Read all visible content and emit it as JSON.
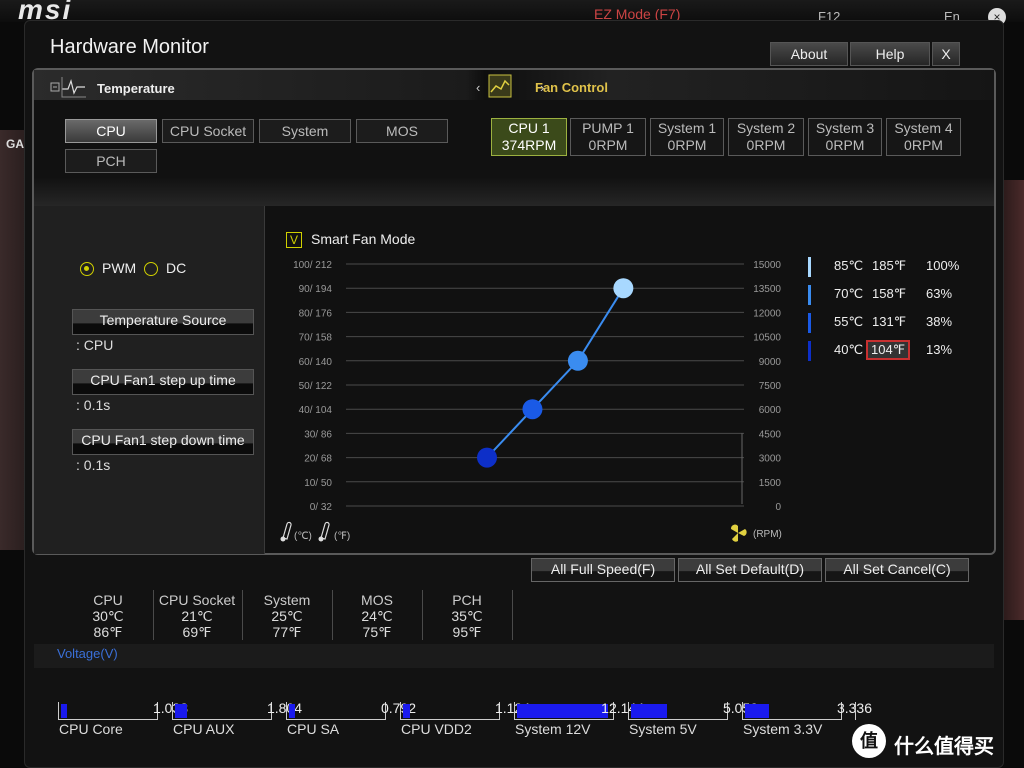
{
  "bg": {
    "logo": "msi",
    "ez_mode": "EZ Mode (F7)",
    "f12": "F12",
    "lang": "En",
    "close": "×",
    "side": "GA"
  },
  "window": {
    "title": "Hardware Monitor",
    "about": "About",
    "help": "Help",
    "close": "X"
  },
  "tabs": {
    "temperature": "Temperature",
    "fan_control": "Fan Control",
    "fan_arrows": "‹ ›"
  },
  "sources": [
    "CPU",
    "CPU Socket",
    "System",
    "MOS",
    "PCH"
  ],
  "fans": [
    {
      "name": "CPU 1",
      "rpm": "374RPM"
    },
    {
      "name": "PUMP 1",
      "rpm": "0RPM"
    },
    {
      "name": "System 1",
      "rpm": "0RPM"
    },
    {
      "name": "System 2",
      "rpm": "0RPM"
    },
    {
      "name": "System 3",
      "rpm": "0RPM"
    },
    {
      "name": "System 4",
      "rpm": "0RPM"
    }
  ],
  "mode": {
    "pwm": "PWM",
    "dc": "DC",
    "selected": "PWM"
  },
  "temp_source": {
    "label": "Temperature Source",
    "value": ": CPU"
  },
  "step_up": {
    "label": "CPU Fan1 step up time",
    "value": ": 0.1s"
  },
  "step_down": {
    "label": "CPU Fan1 step down time",
    "value": ": 0.1s"
  },
  "smart_fan": {
    "check": "V",
    "label": "Smart Fan Mode"
  },
  "chart_data": {
    "type": "line",
    "title": "",
    "y_left_ticks": [
      "100/ 212",
      "90/ 194",
      "80/ 176",
      "70/ 158",
      "60/ 140",
      "50/ 122",
      "40/ 104",
      "30/  86",
      "20/  68",
      "10/  50",
      "0/  32"
    ],
    "y_right_ticks": [
      "15000",
      "13500",
      "12000",
      "10500",
      "9000",
      "7500",
      "6000",
      "4500",
      "3000",
      "1500",
      "0"
    ],
    "left_unit_c": "(℃)",
    "left_unit_f": "(℉)",
    "right_unit": "(RPM)",
    "ylim": [
      0,
      100
    ],
    "series": [
      {
        "x": [
          40,
          55,
          70,
          85
        ],
        "y": [
          20,
          40,
          60,
          90
        ]
      }
    ],
    "point_colors": [
      "#0d2fc8",
      "#1a5ae6",
      "#3a8cf0",
      "#a8d8ff"
    ],
    "line_color": "#3a8cf0"
  },
  "curve_table": [
    {
      "c": "85℃",
      "f": "185℉",
      "pct": "100%",
      "color": "#a8d8ff"
    },
    {
      "c": "70℃",
      "f": "158℉",
      "pct": "63%",
      "color": "#3a8cf0"
    },
    {
      "c": "55℃",
      "f": "131℉",
      "pct": "38%",
      "color": "#1a5ae6"
    },
    {
      "c": "40℃",
      "f": "104℉",
      "pct": "13%",
      "color": "#0d2fc8"
    }
  ],
  "bottom_buttons": {
    "full": "All Full Speed(F)",
    "default": "All Set Default(D)",
    "cancel": "All Set Cancel(C)"
  },
  "temps": [
    {
      "name": "CPU",
      "c": "30℃",
      "f": "86℉"
    },
    {
      "name": "CPU Socket",
      "c": "21℃",
      "f": "69℉"
    },
    {
      "name": "System",
      "c": "25℃",
      "f": "77℉"
    },
    {
      "name": "MOS",
      "c": "24℃",
      "f": "75℉"
    },
    {
      "name": "PCH",
      "c": "35℃",
      "f": "95℉"
    }
  ],
  "voltage": {
    "label": "Voltage(V)",
    "items": [
      {
        "name": "CPU Core",
        "value": "1.038",
        "fill": 0.06
      },
      {
        "name": "CPU AUX",
        "value": "1.804",
        "fill": 0.12
      },
      {
        "name": "CPU SA",
        "value": "0.792",
        "fill": 0.05
      },
      {
        "name": "CPU VDD2",
        "value": "1.124",
        "fill": 0.07
      },
      {
        "name": "System 12V",
        "value": "12.144",
        "fill": 0.95
      },
      {
        "name": "System 5V",
        "value": "5.050",
        "fill": 0.38
      },
      {
        "name": "System 3.3V",
        "value": "3.336",
        "fill": 0.25
      }
    ]
  },
  "watermark": {
    "icon": "值",
    "text": "什么值得买"
  }
}
